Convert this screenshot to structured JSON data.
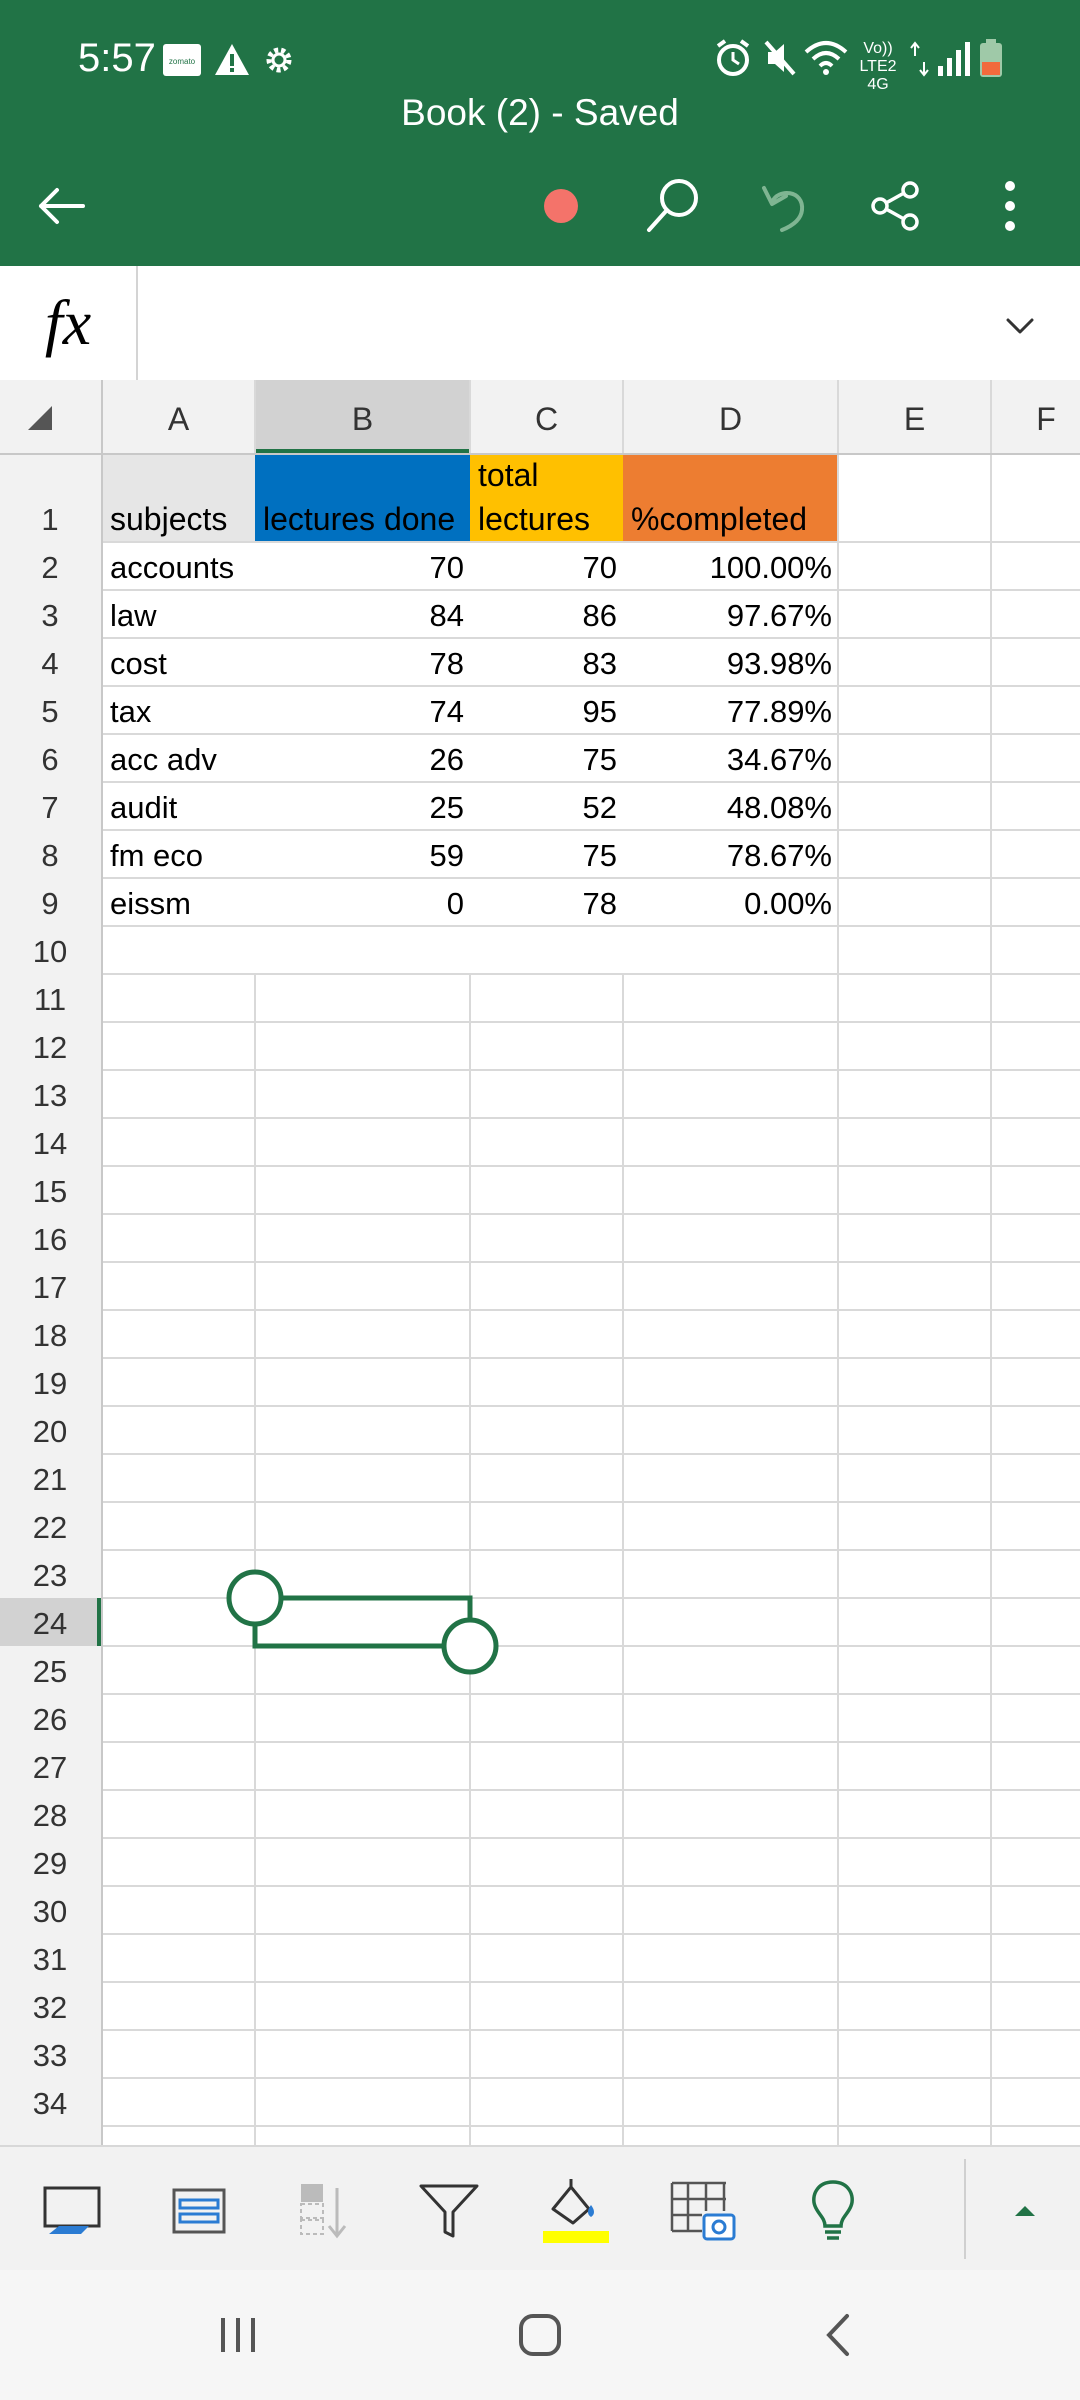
{
  "status_bar": {
    "time": "5:57",
    "network": "Vo)) LTE2 4G"
  },
  "toolbar": {
    "title": "Book (2) - Saved"
  },
  "formula_bar": {
    "fx_label": "fx",
    "value": ""
  },
  "sheet": {
    "columns": [
      "A",
      "B",
      "C",
      "D",
      "E",
      "F"
    ],
    "selected_column": "B",
    "selected_row": 24,
    "row_numbers": [
      1,
      2,
      3,
      4,
      5,
      6,
      7,
      8,
      9,
      10,
      11,
      12,
      13,
      14,
      15,
      16,
      17,
      18,
      19,
      20,
      21,
      22,
      23,
      24,
      25,
      26,
      27,
      28,
      29,
      30,
      31,
      32,
      33,
      34
    ],
    "header_row": [
      {
        "lines": [
          "subjects"
        ],
        "fill": "#e6e6e6",
        "color": "#000000"
      },
      {
        "lines": [
          "lectures done"
        ],
        "fill": "#0070c0",
        "color": "#000000"
      },
      {
        "lines": [
          "total",
          "lectures"
        ],
        "fill": "#ffc000",
        "color": "#000000"
      },
      {
        "lines": [
          "%completed"
        ],
        "fill": "#ed7d31",
        "color": "#000000"
      }
    ],
    "rows": [
      [
        "accounts",
        "70",
        "70",
        "100.00%"
      ],
      [
        "law",
        "84",
        "86",
        "97.67%"
      ],
      [
        "cost",
        "78",
        "83",
        "93.98%"
      ],
      [
        "tax",
        "74",
        "95",
        "77.89%"
      ],
      [
        "acc adv",
        "26",
        "75",
        "34.67%"
      ],
      [
        "audit",
        "25",
        "52",
        "48.08%"
      ],
      [
        "fm eco",
        "59",
        "75",
        "78.67%"
      ],
      [
        "eissm",
        "0",
        "78",
        "0.00%"
      ]
    ]
  },
  "bottom_toolbar": {
    "icons": [
      "sheet-view-icon",
      "sheets-list-icon",
      "sort-icon",
      "filter-icon",
      "fill-color-icon",
      "insert-table-snapshot-icon",
      "ideas-lightbulb-icon",
      "expand-ribbon-icon"
    ],
    "fill_color": "#ffff00"
  },
  "colors": {
    "accent": "#217346",
    "recording_dot": "#f4736a",
    "gridline": "#d9d9d9",
    "header_bg": "#f2f2f2",
    "selected_header_bg": "#d2d2d2"
  }
}
